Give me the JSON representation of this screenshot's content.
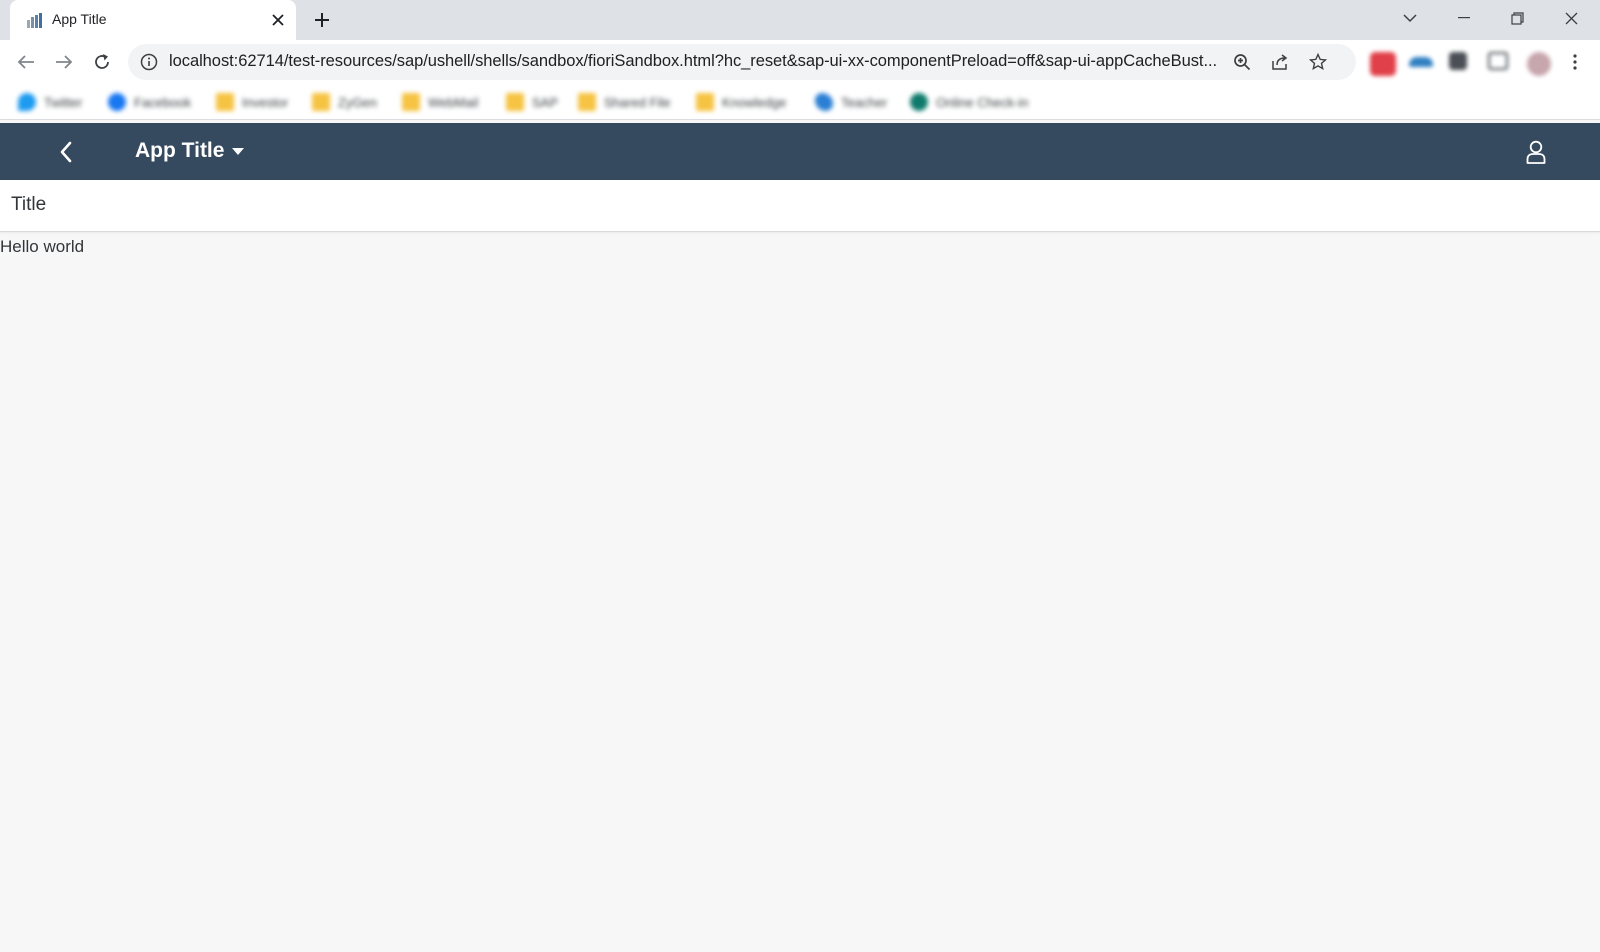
{
  "browser": {
    "tab": {
      "title": "App Title"
    },
    "address_bar": {
      "url": "localhost:62714/test-resources/sap/ushell/shells/sandbox/fioriSandbox.html?hc_reset&sap-ui-xx-componentPreload=off&sap-ui-appCacheBust..."
    },
    "bookmarks": [
      {
        "label": "Twitter",
        "icon": "twitter-icon",
        "color": "#1d9bf0"
      },
      {
        "label": "Facebook",
        "icon": "facebook-icon",
        "color": "#1877f2"
      },
      {
        "label": "Investor",
        "icon": "folder-icon",
        "color": "#f6c342"
      },
      {
        "label": "ZyGen",
        "icon": "folder-icon",
        "color": "#f6c342"
      },
      {
        "label": "WebMail",
        "icon": "folder-icon",
        "color": "#f6c342"
      },
      {
        "label": "SAP",
        "icon": "folder-icon",
        "color": "#f6c342"
      },
      {
        "label": "Shared File",
        "icon": "folder-icon",
        "color": "#f6c342"
      },
      {
        "label": "Knowledge",
        "icon": "folder-icon",
        "color": "#f6c342"
      },
      {
        "label": "Teacher",
        "icon": "teacher-icon",
        "color": "#2a7fd4"
      },
      {
        "label": "Online Check-in",
        "icon": "globe-icon",
        "color": "#0f7a6c"
      }
    ]
  },
  "shell": {
    "app_title": "App Title",
    "background_color": "#354a5f"
  },
  "page": {
    "title": "Title",
    "content_text": "Hello world"
  }
}
